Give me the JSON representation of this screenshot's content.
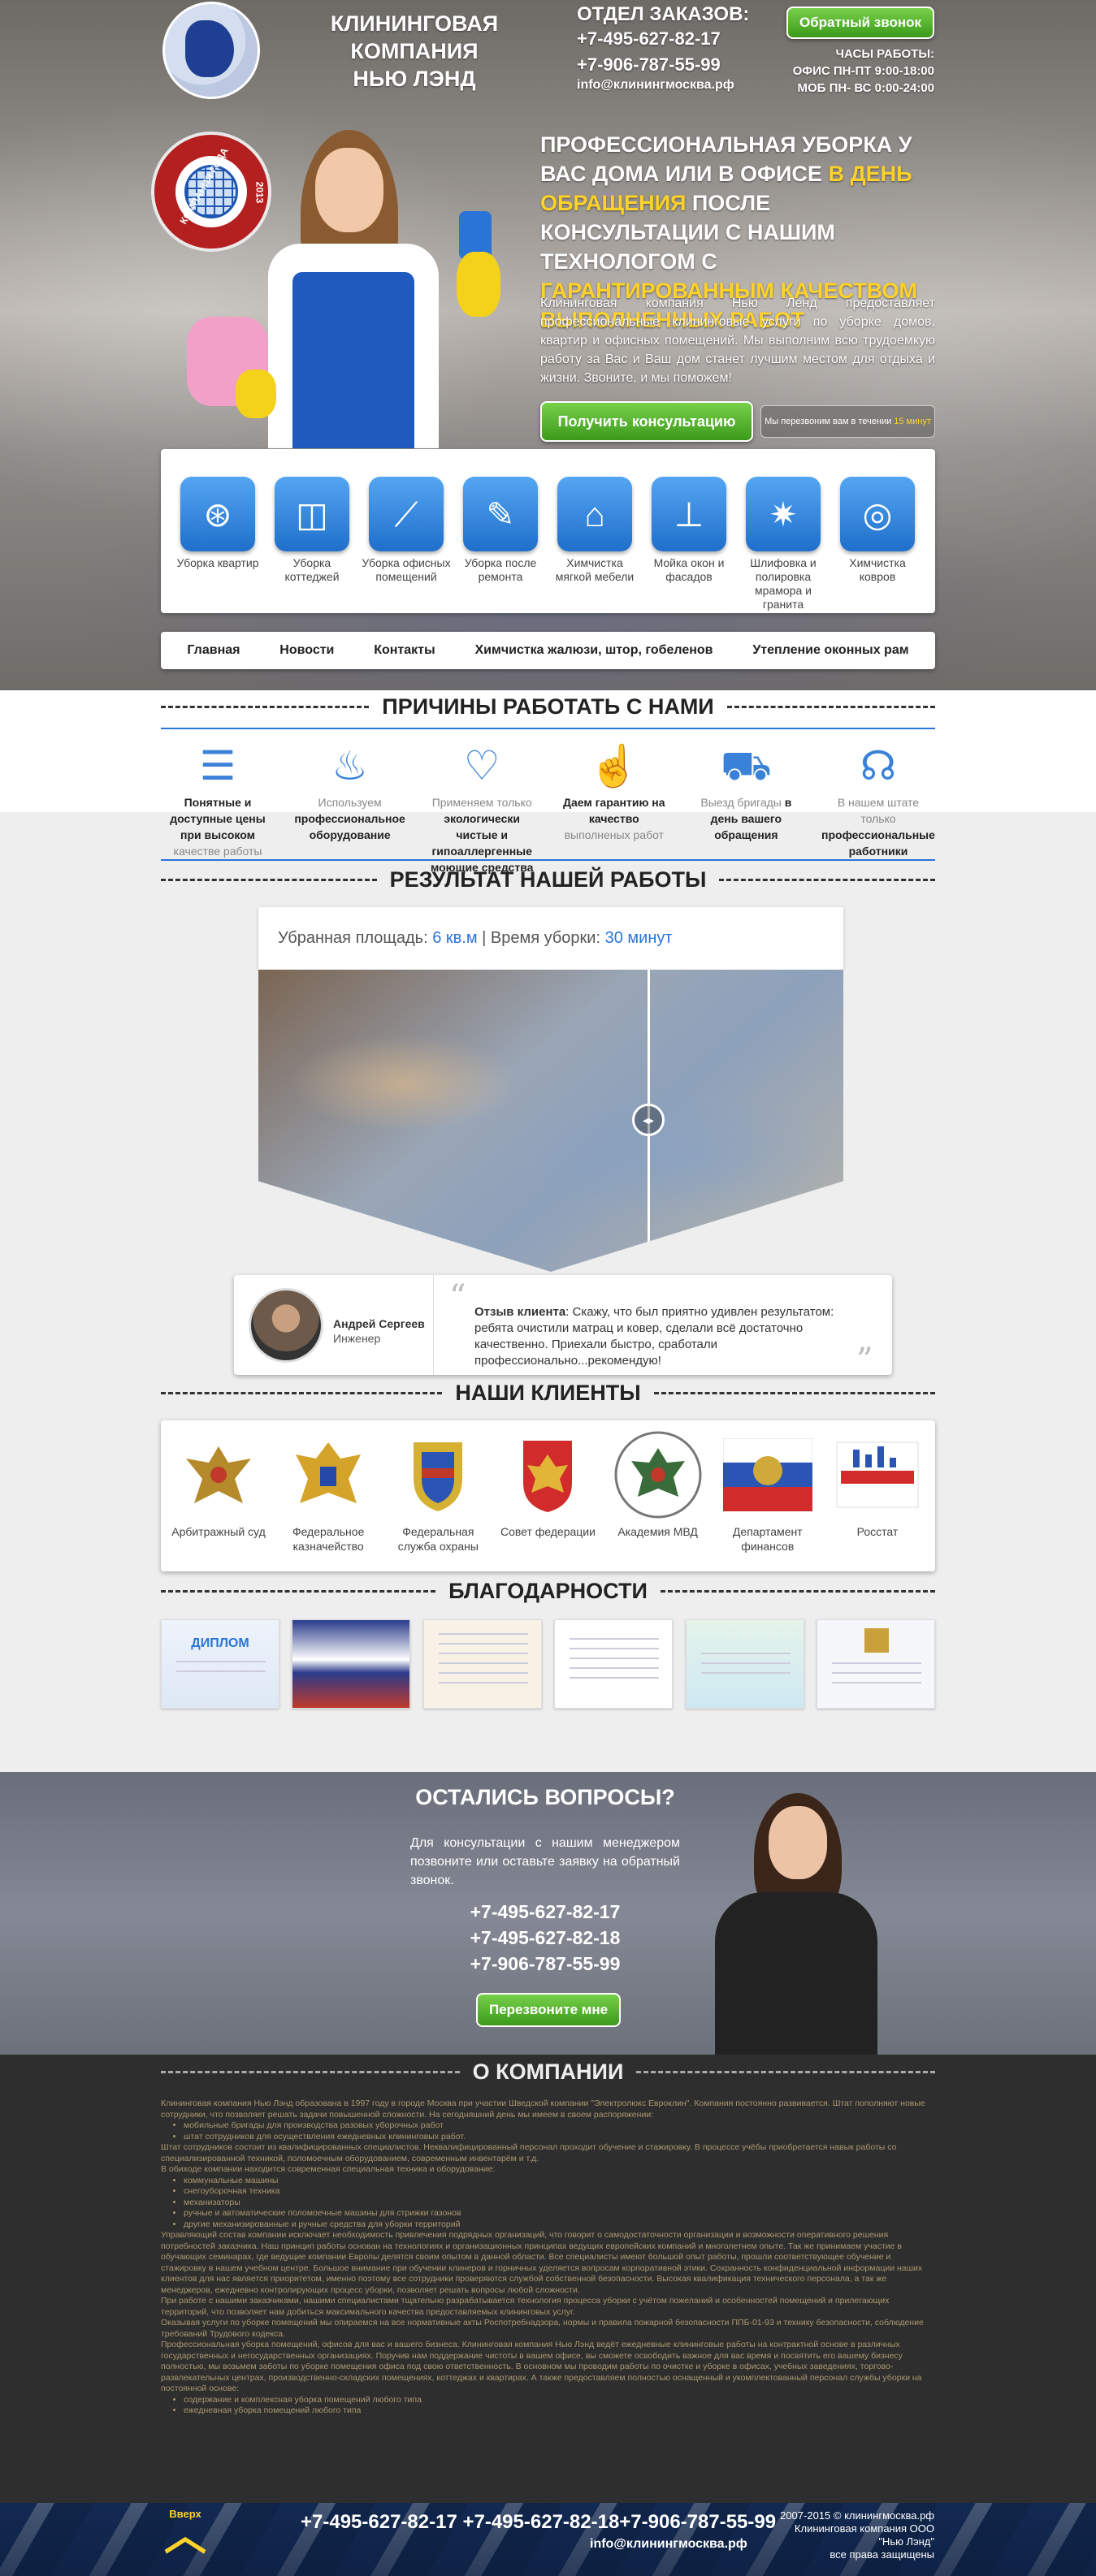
{
  "header": {
    "company_line1": "КЛИНИНГОВАЯ КОМПАНИЯ",
    "company_line2": "НЬЮ ЛЭНД",
    "orders_title": "ОТДЕЛ ЗАКАЗОВ:",
    "phone1": "+7-495-627-82-17",
    "phone2": "+7-906-787-55-99",
    "email": "info@клинингмосква.рф",
    "callback_button": "Обратный звонок",
    "hours_title": "ЧАСЫ РАБОТЫ:",
    "hours_office": "ОФИС ПН-ПТ 9:00-18:00",
    "hours_mob": "МОБ ПН- ВС 0:00-24:00"
  },
  "badge": {
    "left": "КОМПАНИЯ ГОДА",
    "right": "2013"
  },
  "hero": {
    "headline_part1": "ПРОФЕССИОНАЛЬНАЯ УБОРКА У ВАС ДОМА ИЛИ В ОФИСЕ ",
    "headline_yellow1": "В ДЕНЬ ОБРАЩЕНИЯ",
    "headline_part2": " ПОСЛЕ КОНСУЛЬТАЦИИ С НАШИМ ТЕХНОЛОГОМ С ",
    "headline_yellow2": "ГАРАНТИРОВАННЫМ КАЧЕСТВОМ ВЫПОЛНЕННЫХ РАБОТ",
    "lead": "Клининговая компания Нью Ленд предоставляет профессиональные клининговые услуги по уборке домов, квартир и офисных помещений. Мы выполним всю трудоемкую работу за Вас и Ваш дом станет лучшим местом для отдыха и жизни. Звоните, и мы поможем!",
    "consult_button": "Получить консультацию",
    "callnote_text": "Мы перезвоним вам в течении",
    "callnote_time": "15 минут"
  },
  "services": [
    {
      "label": "Уборка квартир",
      "icon": "vacuum-icon"
    },
    {
      "label": "Уборка коттеджей",
      "icon": "bucket-icon"
    },
    {
      "label": "Уборка офисных помещений",
      "icon": "broom-icon"
    },
    {
      "label": "Уборка после ремонта",
      "icon": "brush-icon"
    },
    {
      "label": "Химчистка мягкой мебели",
      "icon": "sofa-icon"
    },
    {
      "label": "Мойка окон и фасадов",
      "icon": "squeegee-icon"
    },
    {
      "label": "Шлифовка и полировка мрамора и гранита",
      "icon": "star-icon"
    },
    {
      "label": "Химчистка ковров",
      "icon": "carpet-icon"
    }
  ],
  "nav": [
    "Главная",
    "Новости",
    "Контакты",
    "Химчистка жалюзи, штор, гобеленов",
    "Утепление оконных рам"
  ],
  "reasons_title": "ПРИЧИНЫ РАБОТАТЬ С НАМИ",
  "reasons": [
    {
      "bold": "Понятные и доступные цены при высоком",
      "light": "качестве работы",
      "icon": "coins-icon"
    },
    {
      "light": "Используем",
      "bold": "профессиональное оборудование",
      "icon": "sprayer-icon"
    },
    {
      "light": "Применяем только",
      "bold": "экологически чистые и гипоаллергенные моющие средства",
      "icon": "heart-icon"
    },
    {
      "bold": "Даем гарантию на качество",
      "light": "выполненых работ",
      "icon": "thumbs-up-icon"
    },
    {
      "light": "Выезд бригады",
      "bold": "в день вашего обращения",
      "icon": "truck-icon"
    },
    {
      "light": "В нашем штате только",
      "bold": "профессиональные работники",
      "icon": "headset-icon"
    }
  ],
  "result": {
    "title": "РЕЗУЛЬТАТ НАШЕЙ РАБОТЫ",
    "area_label": "Убранная площадь:",
    "area_value": "6 кв.м",
    "sep": "|",
    "time_label": "Время уборки:",
    "time_value": "30 минут"
  },
  "review": {
    "name": "Андрей Сергеев",
    "role": "Инженер",
    "label": "Отзыв клиента",
    "text": ": Скажу, что был приятно удивлен результатом: ребята очистили матрац и ковер, сделали всё достаточно качественно. Приехали быстро, сработали профессионально...рекомендую!"
  },
  "clients_title": "НАШИ КЛИЕНТЫ",
  "clients": [
    {
      "label": "Арбитражный суд",
      "icon": "eagle-emblem-icon"
    },
    {
      "label": "Федеральное казначейство",
      "icon": "treasury-emblem-icon"
    },
    {
      "label": "Федеральная служба охраны",
      "icon": "shield-emblem-icon"
    },
    {
      "label": "Совет федерации",
      "icon": "red-shield-emblem-icon"
    },
    {
      "label": "Академия МВД",
      "icon": "round-emblem-icon"
    },
    {
      "label": "Департамент финансов",
      "icon": "flag-emblem-icon"
    },
    {
      "label": "Росстат",
      "icon": "rosstat-logo-icon"
    }
  ],
  "thanks_title": "БЛАГОДАРНОСТИ",
  "thanks": [
    {
      "label": "ДИПЛОМ"
    },
    {
      "label": ""
    },
    {
      "label": ""
    },
    {
      "label": ""
    },
    {
      "label": ""
    },
    {
      "label": ""
    }
  ],
  "questions": {
    "title": "ОСТАЛИСЬ ВОПРОСЫ?",
    "text": "Для консультации с нашим менеджером позвоните или оставьте заявку на обратный звонок.",
    "phone1": "+7-495-627-82-17",
    "phone2": "+7-495-627-82-18",
    "phone3": "+7-906-787-55-99",
    "button": "Перезвоните мне"
  },
  "about": {
    "title": "О КОМПАНИИ",
    "p1": "Клининговая компания Нью Лэнд образована в 1997 году в городе Москва при участии Шведской компании \"Электролюкс Евроклин\". Компания постоянно развивается. Штат пополняют новые сотрудники, что позволяет решать задачи повышенной сложности. На сегодняшний день мы имеем в своем распоряжении:",
    "list1": [
      "мобильные бригады для производства разовых уборочных работ",
      "штат сотрудников для осуществления ежедневных клининговых работ."
    ],
    "p2": "Штат сотрудников состоит из квалифицированных специалистов. Неквалифицированный персонал проходит обучение и стажировку. В процессе учёбы приобретается навык работы со специализированной техникой, поломоечным оборудованием, современным инвентарём и т.д.",
    "p3": "В обиходе компании находится современная специальная техника и оборудование:",
    "list2": [
      "коммунальные машины",
      "снегоуборочная техника",
      "механизаторы",
      "ручные и автоматические поломоечные машины для стрижки газонов",
      "другие механизированные и ручные средства для уборки территорий"
    ],
    "p4": "Управляющий состав компании исключает необходимость привлечения подрядных организаций, что говорит о самодостаточности организации и возможности оперативного решения потребностей заказчика. Наш принцип работы основан на технологиях и организационных принципах ведущих европейских компаний и многолетнем опыте. Так же принимаем участие в обучающих семинарах, где ведущие компании Европы делятся своим опытом в данной области. Все специалисты имеют большой опыт работы, прошли соответствующее обучение и стажировку в нашем учебном центре. Большое внимание при обучении клинеров и горничных уделяется вопросам корпоративной этики. Сохранность конфиденциальной информации наших клиентов для нас является приоритетом, именно поэтому все сотрудники проверяются службой собственной безопасности. Высокая квалификация технического персонала, а так же менеджеров, ежедневно контролирующих процесс уборки, позволяет решать вопросы любой сложности.",
    "p5": "При работе с нашими заказчиками, нашими специалистами тщательно разрабатывается технология процесса уборки с учётом пожеланий и особенностей помещений и прилегающих территорий, что позволяет нам добиться максимального качества предоставляемых клининговых услуг.",
    "p6": "Оказывая услуги по уборке помещений мы опираемся на все нормативные акты Роспотребнадзора, нормы и правила пожарной безопасности ППБ-01-93 и технику безопасности, соблюдение требований Трудового кодекса.",
    "p7": "Профессиональная уборка помещений, офисов для вас и вашего бизнеса. Клининговая компания Нью Лэнд ведёт ежедневные клининговые работы на контрактной основе в различных государственных и негосударственных организациях. Поручив нам поддержание чистоты в вашем офисе, вы сможете освободить важное для вас время и посвятить его вашему бизнесу полностью, мы возьмем заботы по уборке помещения офиса под свою ответственность. В основном мы проводим работы по очистке и уборке в офисах, учебных заведениях, торгово-развлекательных центрах, производственно-складских помещениях, коттеджах и квартирах. А также предоставляем полностью оснащенный и укомплектованный персонал службы уборки на постоянной основе:",
    "list3": [
      "содержание и комплексная уборка помещений любого типа",
      "ежедневная уборка помещений любого типа"
    ]
  },
  "footer": {
    "up_label": "Вверх",
    "phones": "+7-495-627-82-17 +7-495-627-82-18+7-906-787-55-99",
    "email": "info@клинингмосква.рф",
    "copy1": "2007-2015 © клинингмосква.рф",
    "copy2": "Клининговая компания ООО",
    "copy3": "\"Нью Лэнд\"",
    "copy4": "все права защищены"
  }
}
